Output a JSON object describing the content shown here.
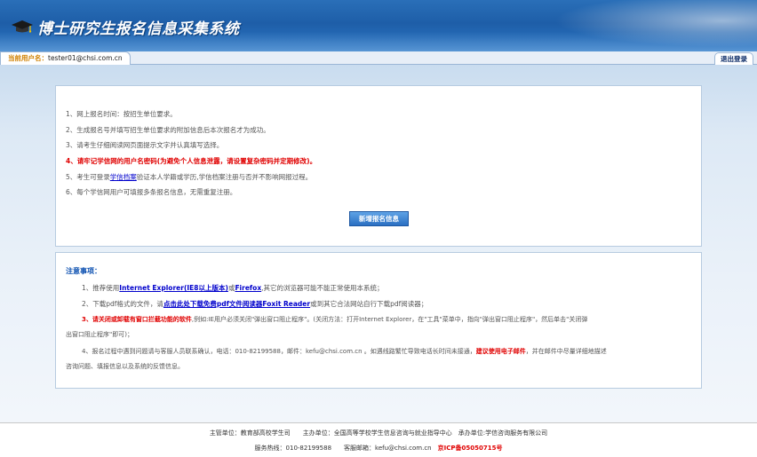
{
  "header": {
    "title": "博士研究生报名信息采集系统"
  },
  "userbar": {
    "label": "当前用户名：",
    "username": "tester01@chsi.com.cn",
    "logout": "退出登录"
  },
  "info": {
    "items": [
      "1、网上报名时间：按招生单位要求。",
      "2、生成报名号并填写招生单位要求的附加信息后本次报名才为成功。",
      "3、请考生仔细阅读网页面提示文字并认真填写选择。",
      "4、请牢记学信网的用户名密码(为避免个人信息泄露，请设置复杂密码并定期修改)。",
      "6、每个学信网用户可填报多条报名信息，无需重复注册。"
    ],
    "item5_pre": "5、考生可登录",
    "item5_link": "学信档案",
    "item5_post": "验证本人学籍或学历,学信档案注册与否并不影响网报过程。",
    "new_button": "新增报名信息"
  },
  "notice": {
    "title": "注意事项：",
    "n1_pre": "1、推荐使用",
    "n1_link1": "Internet Explorer(IE8以上版本)",
    "n1_mid": "或",
    "n1_link2": "Firefox",
    "n1_post": ",其它的浏览器可能不能正常使用本系统；",
    "n2_pre": "2、下载pdf格式的文件，请",
    "n2_link": "点击此处下载免费pdf文件阅读器Foxit Reader",
    "n2_post": "或到其它合法网站自行下载pdf阅读器；",
    "n3_red": "3、请关闭或卸载有窗口拦截功能的软件",
    "n3_post": ",例如:IE用户必须关闭\"弹出窗口阻止程序\"。(关闭方法：打开Internet Explorer，在\"工具\"菜单中，指向\"弹出窗口阻止程序\"，然后单击\"关闭弹",
    "n3_line2": "出窗口阻止程序\"即可)；",
    "n4_pre": "4、报名过程中遇到问题请与客服人员联系确认，电话：010-82199588，邮件：kefu@chsi.com.cn 。如遇线路繁忙导致电话长时间未接通，",
    "n4_red": "建议使用电子邮件",
    "n4_post": "，并在邮件中尽量详细地描述",
    "n4_line2": "咨询问题、填报信息以及系统的反馈信息。"
  },
  "footer": {
    "line1": "主管单位：教育部高校学生司　　主办单位：全国高等学校学生信息咨询与就业指导中心　承办单位:学信咨询服务有限公司",
    "hotline": "服务热线：010-82199588　　客服邮箱：kefu@chsi.com.cn",
    "icp": "京ICP备05050715号"
  },
  "colors": {
    "header_blue": "#1e5ea8",
    "accent_red": "#e00000",
    "link_blue": "#0000cc",
    "username_label": "#d08000"
  }
}
